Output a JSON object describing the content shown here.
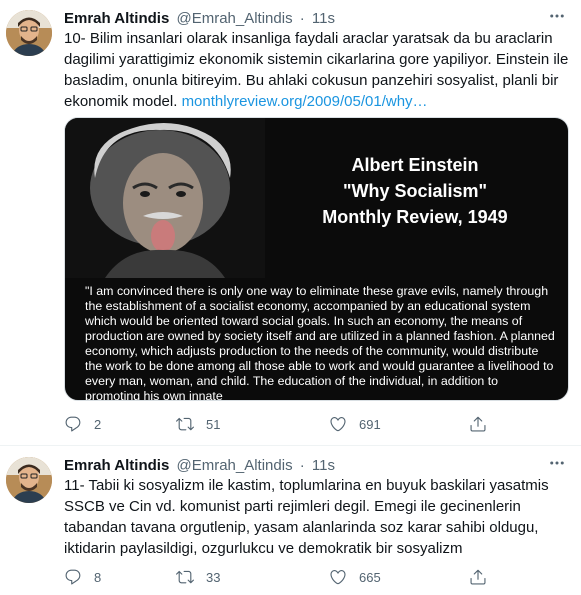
{
  "tweets": [
    {
      "author": "Emrah Altindis",
      "handle": "@Emrah_Altindis",
      "time": "11s",
      "text": "10- Bilim insanlari olarak insanliga faydali araclar yaratsak da bu araclarin dagilimi yarattigimiz ekonomik sistemin cikarlarina gore yapiliyor. Einstein ile basladim, onunla bitireyim. Bu ahlaki cokusun panzehiri sosyalist, planli bir ekonomik model.",
      "link": "monthlyreview.org/2009/05/01/why…",
      "media": {
        "title_line1": "Albert Einstein",
        "title_line2": "\"Why Socialism\"",
        "title_line3": "Monthly Review, 1949",
        "quote": "\"I am convinced there is only one way to eliminate these grave evils, namely through the establishment of a socialist economy, accompanied by an educational system which would be oriented toward social goals. In such an economy, the means of production are owned by society itself and are utilized in a planned fashion. A planned economy, which adjusts production to the needs of the community, would distribute the work to be done among all those able to work and would guarantee a livelihood to every man, woman, and child. The education of the individual, in addition to promoting his own innate"
      },
      "replies": "2",
      "retweets": "51",
      "likes": "691"
    },
    {
      "author": "Emrah Altindis",
      "handle": "@Emrah_Altindis",
      "time": "11s",
      "text": "11- Tabii ki sosyalizm ile kastim, toplumlarina en buyuk baskilari yasatmis SSCB ve Cin vd. komunist parti rejimleri degil. Emegi ile gecinenlerin tabandan tavana orgutlenip, yasam alanlarinda soz karar sahibi oldugu, iktidarin paylasildigi, ozgurlukcu ve demokratik bir sosyalizm",
      "replies": "8",
      "retweets": "33",
      "likes": "665"
    }
  ],
  "separator": "·",
  "icons": [
    "avatar",
    "more-icon",
    "reply-icon",
    "retweet-icon",
    "like-icon",
    "share-icon"
  ],
  "colors": {
    "link": "#1b95e0",
    "muted": "#536471",
    "text": "#0f1419",
    "border": "#eff3f4"
  }
}
